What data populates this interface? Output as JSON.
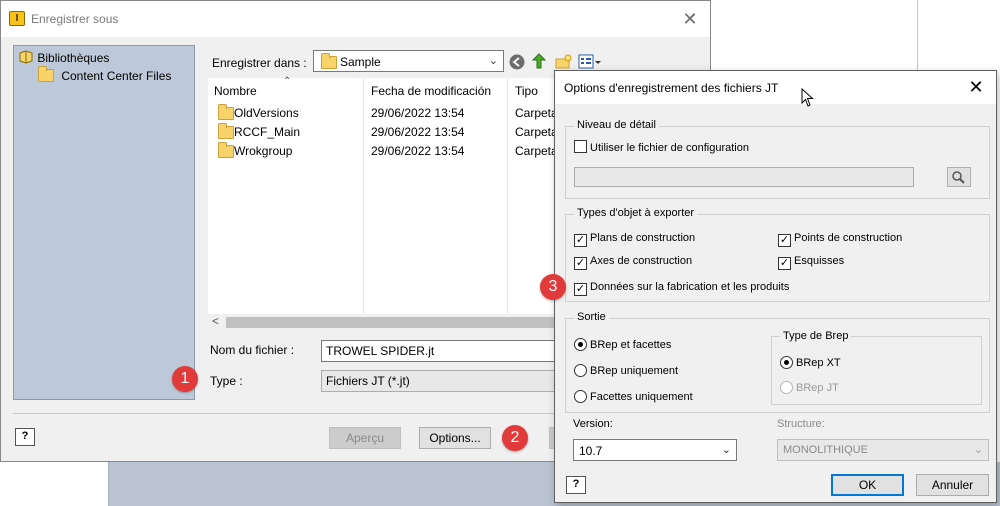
{
  "save_dialog": {
    "title": "Enregistrer sous",
    "tree": [
      "Bibliothèques",
      "Content Center Files"
    ],
    "save_in_label": "Enregistrer dans :",
    "save_in_value": "Sample",
    "columns": [
      "Nombre",
      "Fecha de modificación",
      "Tipo"
    ],
    "rows": [
      {
        "name": "OldVersions",
        "date": "29/06/2022 13:54",
        "type": "Carpeta"
      },
      {
        "name": "RCCF_Main",
        "date": "29/06/2022 13:54",
        "type": "Carpeta"
      },
      {
        "name": "Wrokgroup",
        "date": "29/06/2022 13:54",
        "type": "Carpeta"
      }
    ],
    "filename_label": "Nom du fichier :",
    "filename_value": "TROWEL SPIDER.jt",
    "type_label": "Type :",
    "type_value": "Fichiers JT (*.jt)",
    "preview_button": "Aperçu",
    "options_button": "Options...",
    "help_glyph": "?"
  },
  "badges": [
    "1",
    "2",
    "3"
  ],
  "options_dialog": {
    "title": "Options d'enregistrement des fichiers JT",
    "detail_group": "Niveau de détail",
    "use_config": "Utiliser le fichier de configuration",
    "config_path": "",
    "types_group": "Types d'objet à exporter",
    "plans": "Plans de construction",
    "points": "Points de construction",
    "axes": "Axes de construction",
    "sketches": "Esquisses",
    "manufacturing": "Données sur la fabrication et les produits",
    "output_group": "Sortie",
    "brep_facets": "BRep et facettes",
    "brep_only": "BRep uniquement",
    "facets_only": "Facettes uniquement",
    "brep_type_group": "Type de Brep",
    "brep_xt": "BRep XT",
    "brep_jt": "BRep JT",
    "version_label": "Version:",
    "version_value": "10.7",
    "structure_label": "Structure:",
    "structure_value": "MONOLITHIQUE",
    "ok": "OK",
    "cancel": "Annuler",
    "help_glyph": "?"
  },
  "colors": {
    "accent": "#0078d7",
    "badge": "#e03a3a",
    "left_panel": "#bdc9d8"
  }
}
